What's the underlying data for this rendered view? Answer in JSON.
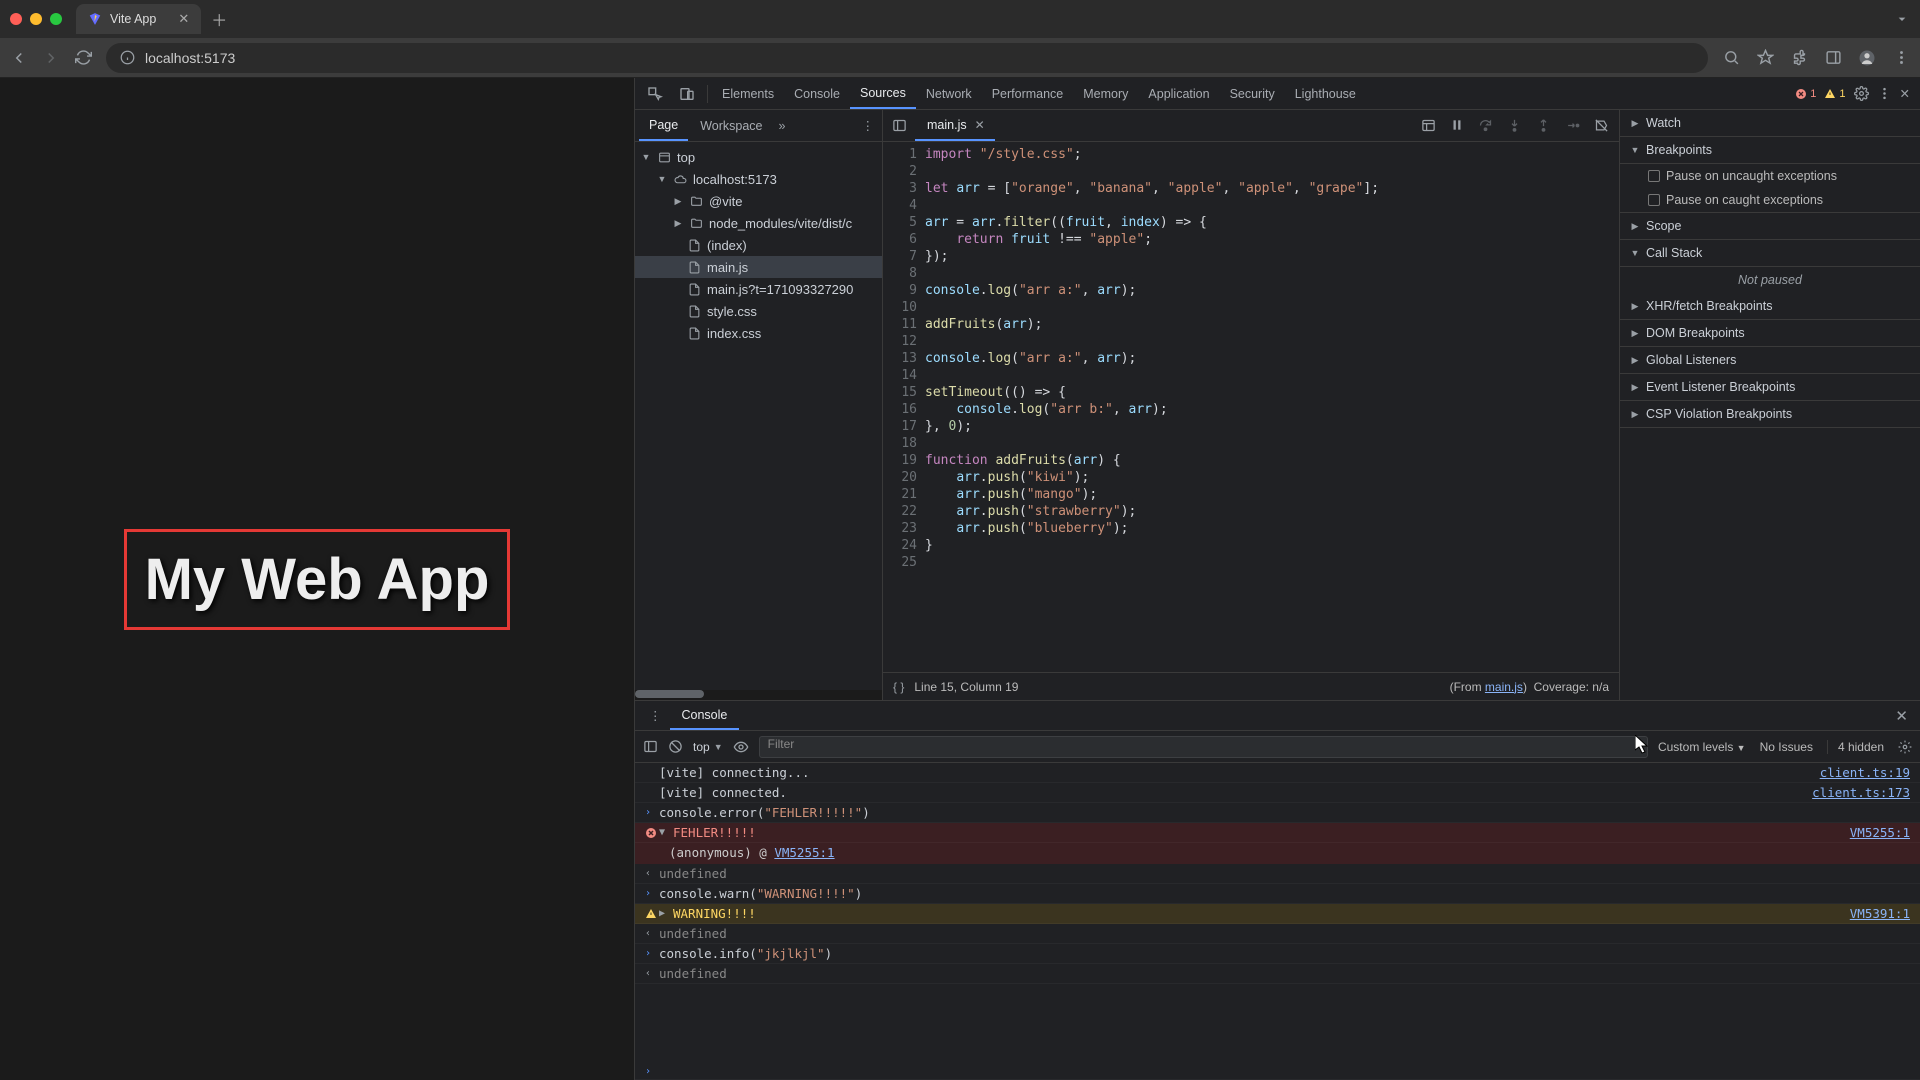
{
  "browser": {
    "tab_title": "Vite App",
    "url": "localhost:5173"
  },
  "page": {
    "heading": "My Web App"
  },
  "devtools": {
    "tabs": [
      "Elements",
      "Console",
      "Sources",
      "Network",
      "Performance",
      "Memory",
      "Application",
      "Security",
      "Lighthouse"
    ],
    "active_tab": "Sources",
    "error_count": "1",
    "warn_count": "1"
  },
  "sources_nav": {
    "tabs": [
      "Page",
      "Workspace"
    ],
    "active": "Page",
    "tree": {
      "top": "top",
      "host": "localhost:5173",
      "folder1": "@vite",
      "folder2": "node_modules/vite/dist/c",
      "files": [
        "(index)",
        "main.js",
        "main.js?t=171093327290",
        "style.css",
        "index.css"
      ],
      "selected": "main.js"
    }
  },
  "editor": {
    "tab": "main.js",
    "lines": 25,
    "code": [
      {
        "n": 1,
        "html": "<span class='kw'>import</span> <span class='str'>\"/style.css\"</span>;"
      },
      {
        "n": 2,
        "html": ""
      },
      {
        "n": 3,
        "html": "<span class='kw'>let</span> <span class='var'>arr</span> = [<span class='str'>\"orange\"</span>, <span class='str'>\"banana\"</span>, <span class='str'>\"apple\"</span>, <span class='str'>\"apple\"</span>, <span class='str'>\"grape\"</span>];"
      },
      {
        "n": 4,
        "html": ""
      },
      {
        "n": 5,
        "html": "<span class='var'>arr</span> = <span class='var'>arr</span>.<span class='fn'>filter</span>((<span class='prm'>fruit</span>, <span class='prm'>index</span>) =&gt; {"
      },
      {
        "n": 6,
        "html": "    <span class='kw'>return</span> <span class='var'>fruit</span> !== <span class='str'>\"apple\"</span>;"
      },
      {
        "n": 7,
        "html": "});"
      },
      {
        "n": 8,
        "html": ""
      },
      {
        "n": 9,
        "html": "<span class='var'>console</span>.<span class='fn'>log</span>(<span class='str'>\"arr a:\"</span>, <span class='var'>arr</span>);"
      },
      {
        "n": 10,
        "html": ""
      },
      {
        "n": 11,
        "html": "<span class='fn'>addFruits</span>(<span class='var'>arr</span>);"
      },
      {
        "n": 12,
        "html": ""
      },
      {
        "n": 13,
        "html": "<span class='var'>console</span>.<span class='fn'>log</span>(<span class='str'>\"arr a:\"</span>, <span class='var'>arr</span>);"
      },
      {
        "n": 14,
        "html": ""
      },
      {
        "n": 15,
        "html": "<span class='fn'>setTimeout</span>(() =&gt; {"
      },
      {
        "n": 16,
        "html": "    <span class='var'>console</span>.<span class='fn'>log</span>(<span class='str'>\"arr b:\"</span>, <span class='var'>arr</span>);"
      },
      {
        "n": 17,
        "html": "}, <span class='num'>0</span>);"
      },
      {
        "n": 18,
        "html": ""
      },
      {
        "n": 19,
        "html": "<span class='kw'>function</span> <span class='fn'>addFruits</span>(<span class='prm'>arr</span>) {"
      },
      {
        "n": 20,
        "html": "    <span class='var'>arr</span>.<span class='fn'>push</span>(<span class='str'>\"kiwi\"</span>);"
      },
      {
        "n": 21,
        "html": "    <span class='var'>arr</span>.<span class='fn'>push</span>(<span class='str'>\"mango\"</span>);"
      },
      {
        "n": 22,
        "html": "    <span class='var'>arr</span>.<span class='fn'>push</span>(<span class='str'>\"strawberry\"</span>);"
      },
      {
        "n": 23,
        "html": "    <span class='var'>arr</span>.<span class='fn'>push</span>(<span class='str'>\"blueberry\"</span>);"
      },
      {
        "n": 24,
        "html": "}"
      },
      {
        "n": 25,
        "html": ""
      }
    ],
    "status_cursor": "Line 15, Column 19",
    "status_from": "(From ",
    "status_link": "main.js",
    "status_close": ")",
    "coverage": "Coverage: n/a"
  },
  "debug": {
    "sections": {
      "watch": "Watch",
      "breakpoints": "Breakpoints",
      "bp_uncaught": "Pause on uncaught exceptions",
      "bp_caught": "Pause on caught exceptions",
      "scope": "Scope",
      "callstack": "Call Stack",
      "not_paused": "Not paused",
      "xhr": "XHR/fetch Breakpoints",
      "dom": "DOM Breakpoints",
      "global": "Global Listeners",
      "event": "Event Listener Breakpoints",
      "csp": "CSP Violation Breakpoints"
    }
  },
  "console": {
    "tab": "Console",
    "context": "top",
    "filter_placeholder": "Filter",
    "levels": "Custom levels",
    "issues": "No Issues",
    "hidden": "4 hidden",
    "rows": [
      {
        "type": "log",
        "msg": "[vite] connecting...",
        "src": "client.ts:19"
      },
      {
        "type": "log",
        "msg": "[vite] connected.",
        "src": "client.ts:173"
      },
      {
        "type": "input",
        "msg": "console.error(\"FEHLER!!!!!\")",
        "src": ""
      },
      {
        "type": "error",
        "msg": "FEHLER!!!!!",
        "src": "VM5255:1",
        "stack": "(anonymous) @ VM5255:1"
      },
      {
        "type": "result",
        "msg": "undefined",
        "src": ""
      },
      {
        "type": "input",
        "msg": "console.warn(\"WARNING!!!!\")",
        "src": ""
      },
      {
        "type": "warn",
        "msg": "WARNING!!!!",
        "src": "VM5391:1"
      },
      {
        "type": "result",
        "msg": "undefined",
        "src": ""
      },
      {
        "type": "input",
        "msg": "console.info(\"jkjlkjl\")",
        "src": ""
      },
      {
        "type": "result",
        "msg": "undefined",
        "src": ""
      }
    ]
  }
}
